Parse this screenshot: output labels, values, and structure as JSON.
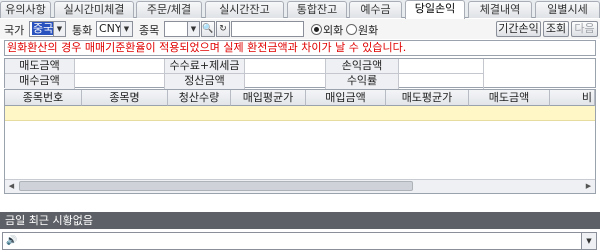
{
  "tabs": [
    "유의사항",
    "실시간미체결",
    "주문/체결",
    "실시간잔고",
    "통합잔고",
    "예수금",
    "당일손익",
    "체결내역",
    "일별시세"
  ],
  "active_tab": 6,
  "filter": {
    "country_label": "국가",
    "country_value": "중국",
    "currency_label": "통화",
    "currency_value": "CNY",
    "stock_label": "종목",
    "radio_foreign": "외화",
    "radio_won": "원화",
    "period_button": "기간손익",
    "query_button": "조회",
    "next_button": "다음"
  },
  "notice": "원화환산의 경우 매매기준환율이 적용되었으며 실제 환전금액과 차이가 날 수 있습니다.",
  "summary": {
    "sell_amount": "매도금액",
    "fee_tax": "수수료+제세금",
    "pnl_amount": "손익금액",
    "buy_amount": "매수금액",
    "settle_amount": "정산금액",
    "return_rate": "수익률"
  },
  "grid": {
    "columns": [
      "종목번호",
      "종목명",
      "청산수량",
      "매입평균가",
      "매입금액",
      "매도평균가",
      "매도금액",
      "비"
    ]
  },
  "status": "금일 최근 시황없음"
}
